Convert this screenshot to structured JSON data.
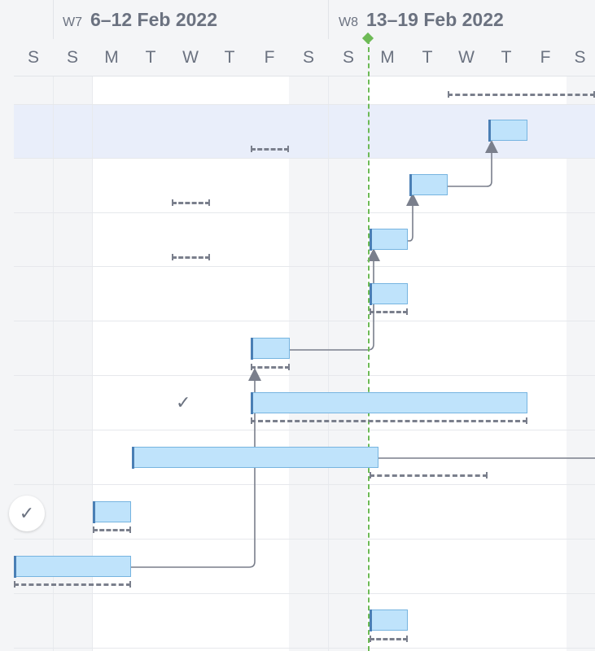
{
  "header": {
    "weeks": [
      {
        "number": "W7",
        "range": "6–12 Feb 2022"
      },
      {
        "number": "W8",
        "range": "13–19 Feb 2022"
      }
    ],
    "days": [
      "S",
      "S",
      "M",
      "T",
      "W",
      "T",
      "F",
      "S",
      "S",
      "M",
      "T",
      "W",
      "T",
      "F",
      "S"
    ]
  },
  "timeline": {
    "today_indicator": "today-marker",
    "colors": {
      "bar_fill": "#bfe3fb",
      "bar_border": "#76b4e0",
      "bar_start": "#4a7fb5",
      "baseline": "#7a7f8c",
      "today": "#6dba56",
      "highlight_row": "#e9eefa"
    }
  },
  "icons": {
    "check": "✓"
  }
}
